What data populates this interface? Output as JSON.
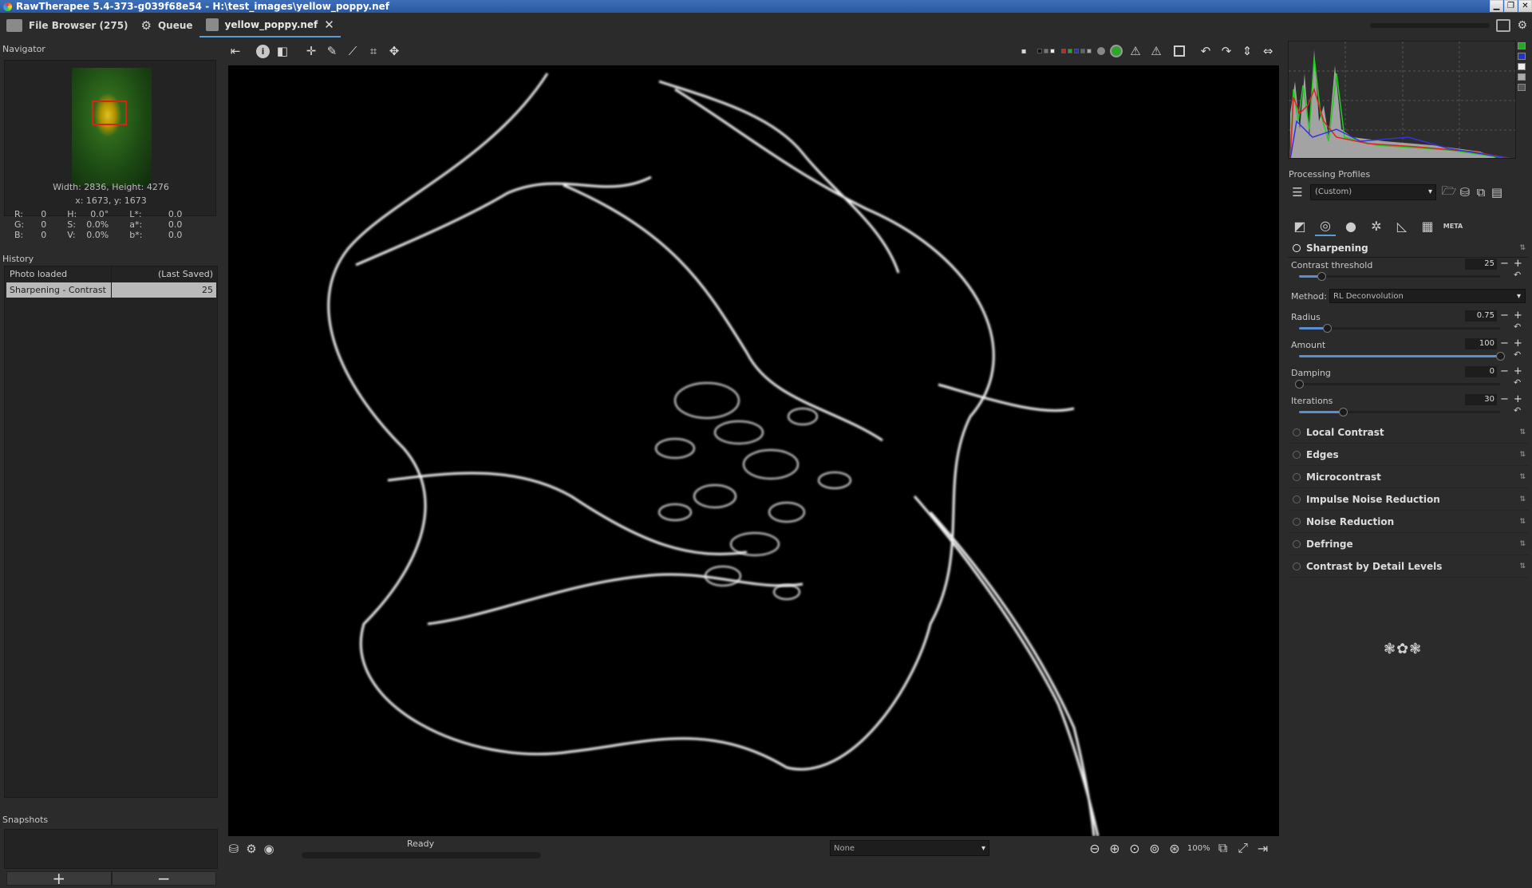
{
  "window": {
    "title": "RawTherapee 5.4-373-g039f68e54 - H:\\test_images\\yellow_poppy.nef"
  },
  "tabs": [
    {
      "label": "File Browser (275)",
      "icon": "folder-icon"
    },
    {
      "label": "Queue",
      "icon": "gears-icon"
    },
    {
      "label": "yellow_poppy.nef",
      "icon": "image-icon"
    }
  ],
  "navigator": {
    "title": "Navigator",
    "size_line": "Width: 2836, Height: 4276",
    "pos_line": "x: 1673, y: 1673",
    "rows": [
      {
        "l1": "R:",
        "v1": "0",
        "l2": "H:",
        "v2": "0.0°",
        "l3": "L*:",
        "v3": "0.0"
      },
      {
        "l1": "G:",
        "v1": "0",
        "l2": "S:",
        "v2": "0.0%",
        "l3": "a*:",
        "v3": "0.0"
      },
      {
        "l1": "B:",
        "v1": "0",
        "l2": "V:",
        "v2": "0.0%",
        "l3": "b*:",
        "v3": "0.0"
      }
    ]
  },
  "history": {
    "title": "History",
    "items": [
      {
        "name": "Photo loaded",
        "value": "(Last Saved)"
      },
      {
        "name": "Sharpening - Contrast t...",
        "value": "25"
      }
    ]
  },
  "snapshots": {
    "title": "Snapshots",
    "add": "+",
    "remove": "−"
  },
  "status": {
    "text": "Ready"
  },
  "bottom": {
    "preview_select": "None",
    "zoom": "100%"
  },
  "profiles": {
    "title": "Processing Profiles",
    "current": "(Custom)"
  },
  "sharpening": {
    "title": "Sharpening",
    "contrast_threshold": {
      "label": "Contrast threshold",
      "value": "25",
      "frac": 0.11
    },
    "method": {
      "label": "Method:",
      "value": "RL Deconvolution"
    },
    "params": [
      {
        "label": "Radius",
        "value": "0.75",
        "frac": 0.14
      },
      {
        "label": "Amount",
        "value": "100",
        "frac": 1.0
      },
      {
        "label": "Damping",
        "value": "0",
        "frac": 0.0
      },
      {
        "label": "Iterations",
        "value": "30",
        "frac": 0.22
      }
    ]
  },
  "tools": [
    "Local Contrast",
    "Edges",
    "Microcontrast",
    "Impulse Noise Reduction",
    "Noise Reduction",
    "Defringe",
    "Contrast by Detail Levels"
  ],
  "tooltabs": {
    "meta": "META"
  }
}
